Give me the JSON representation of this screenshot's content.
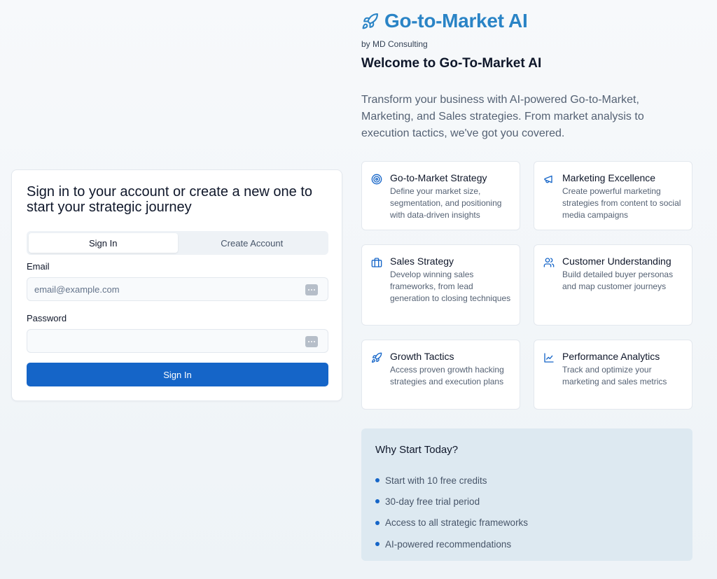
{
  "brand": {
    "name": "Go-to-Market AI",
    "byline": "by MD Consulting",
    "color": "#2a84c6"
  },
  "welcome": {
    "heading": "Welcome to Go-To-Market AI",
    "intro": "Transform your business with AI-powered Go-to-Market, Marketing, and Sales strategies. From market analysis to execution tactics, we've got you covered."
  },
  "auth": {
    "title": "Sign in to your account or create a new one to start your strategic journey",
    "tabs": [
      {
        "label": "Sign In",
        "active": true
      },
      {
        "label": "Create Account",
        "active": false
      }
    ],
    "email": {
      "label": "Email",
      "placeholder": "email@example.com",
      "value": ""
    },
    "password": {
      "label": "Password",
      "placeholder": "",
      "value": ""
    },
    "submit_label": "Sign In",
    "accent": "#1565c8"
  },
  "features": [
    {
      "icon": "target-icon",
      "title": "Go-to-Market Strategy",
      "desc": "Define your market size, segmentation, and positioning with data-driven insights"
    },
    {
      "icon": "megaphone-icon",
      "title": "Marketing Excellence",
      "desc": "Create powerful marketing strategies from content to social media campaigns"
    },
    {
      "icon": "briefcase-icon",
      "title": "Sales Strategy",
      "desc": "Develop winning sales frameworks, from lead generation to closing techniques"
    },
    {
      "icon": "users-icon",
      "title": "Customer Understanding",
      "desc": "Build detailed buyer personas and map customer journeys"
    },
    {
      "icon": "rocket-icon",
      "title": "Growth Tactics",
      "desc": "Access proven growth hacking strategies and execution plans"
    },
    {
      "icon": "line-chart-icon",
      "title": "Performance Analytics",
      "desc": "Track and optimize your marketing and sales metrics"
    }
  ],
  "why": {
    "title": "Why Start Today?",
    "items": [
      "Start with 10 free credits",
      "30-day free trial period",
      "Access to all strategic frameworks",
      "AI-powered recommendations"
    ]
  }
}
